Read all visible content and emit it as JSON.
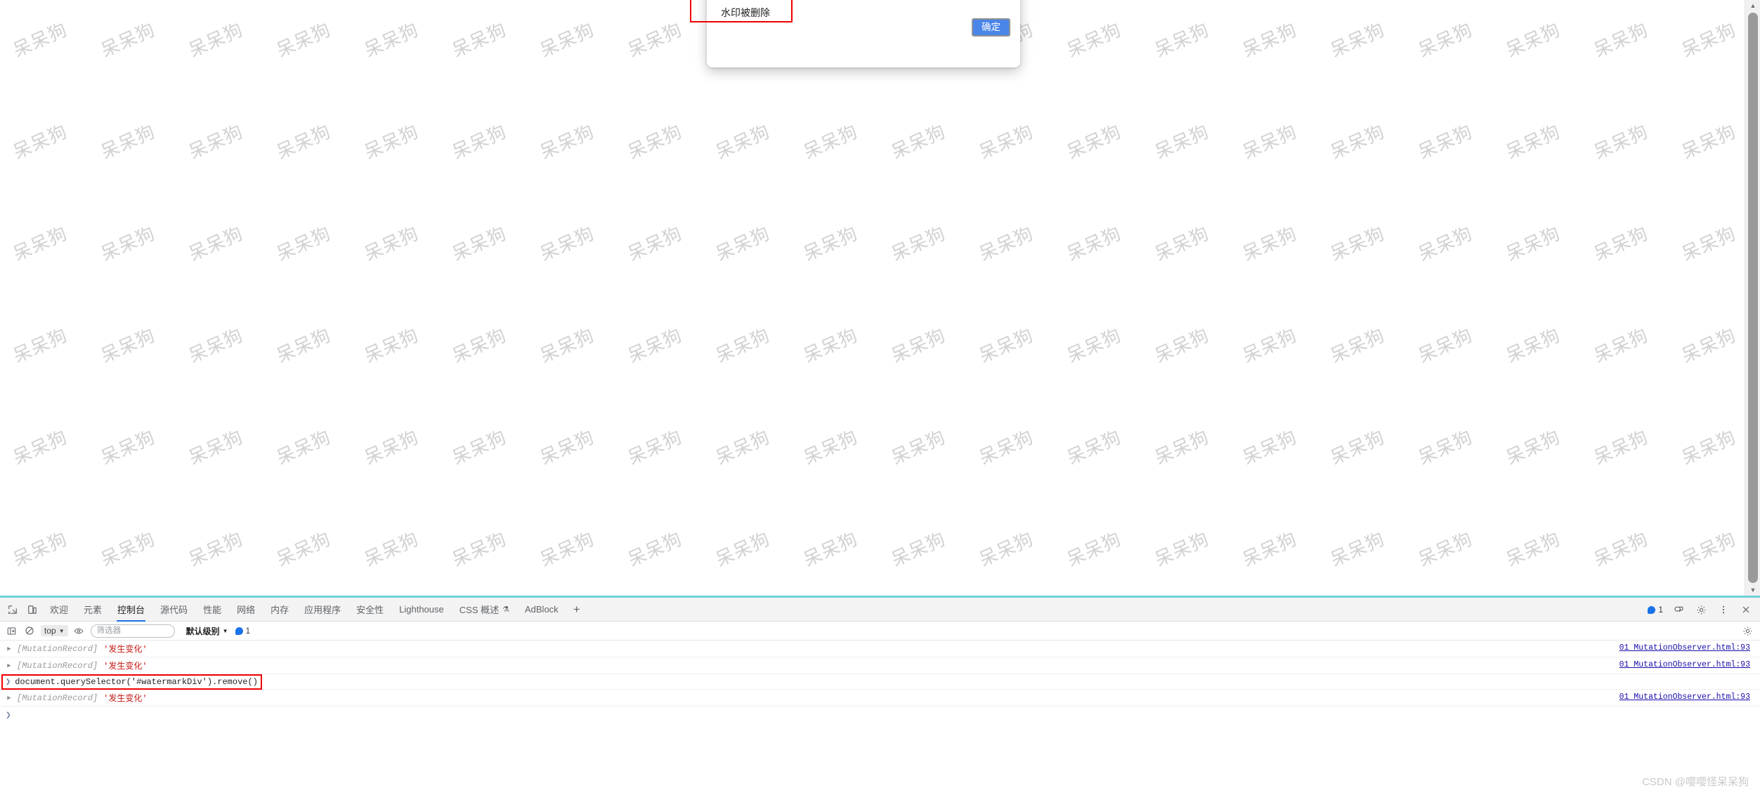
{
  "page": {
    "watermark_text": "呆呆狗",
    "watermark_color": "#d2d2d2",
    "background_color": "#ffffff"
  },
  "dialog": {
    "message": "水印被删除",
    "ok_label": "确定",
    "ok_color": "#4a86e8",
    "annotation_color": "#ef0000"
  },
  "devtools": {
    "tabs": [
      {
        "label": "欢迎",
        "active": false
      },
      {
        "label": "元素",
        "active": false
      },
      {
        "label": "控制台",
        "active": true
      },
      {
        "label": "源代码",
        "active": false
      },
      {
        "label": "性能",
        "active": false
      },
      {
        "label": "网络",
        "active": false
      },
      {
        "label": "内存",
        "active": false
      },
      {
        "label": "应用程序",
        "active": false
      },
      {
        "label": "安全性",
        "active": false
      },
      {
        "label": "Lighthouse",
        "active": false
      },
      {
        "label": "CSS 概述",
        "active": false,
        "flask": "⚗"
      },
      {
        "label": "AdBlock",
        "active": false
      }
    ],
    "add_tab_label": "+",
    "message_count": "1",
    "active_tab_accent": "#1a73e8",
    "console_toolbar": {
      "context_value": "top",
      "filter_placeholder": "筛选器",
      "filter_value": "",
      "level_value": "默认级别",
      "badge_count": "1",
      "caret": "▼"
    },
    "console_rows": [
      {
        "kind": "log",
        "arrow": "▶",
        "obj_type": "[MutationRecord]",
        "value": "'发生变化'",
        "source": "01 MutationObserver.html:93"
      },
      {
        "kind": "log",
        "arrow": "▶",
        "obj_type": "[MutationRecord]",
        "value": "'发生变化'",
        "source": "01 MutationObserver.html:93"
      },
      {
        "kind": "command",
        "prompt": "❯",
        "text": "document.querySelector('#watermarkDiv').remove()",
        "annotated": true
      },
      {
        "kind": "log",
        "arrow": "▶",
        "obj_type": "[MutationRecord]",
        "value": "'发生变化'",
        "source": "01 MutationObserver.html:93"
      }
    ],
    "input_prompt": "❯"
  },
  "footer": {
    "csdn_watermark": "CSDN @嘤嘤怪呆呆狗"
  }
}
